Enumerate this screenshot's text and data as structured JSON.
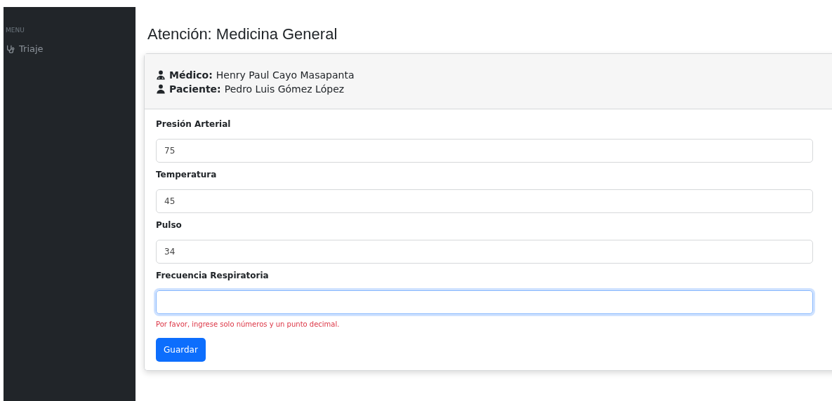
{
  "sidebar": {
    "heading": "MENU",
    "items": [
      {
        "label": "Triaje",
        "selected": false
      }
    ]
  },
  "page_title": "Atención: Medicina General",
  "header": {
    "doctor_label": "Médico:",
    "doctor": "Henry Paul Cayo Masapanta",
    "patient_label": "Paciente:",
    "patient": "Pedro Luis Gómez López"
  },
  "fields": [
    {
      "label": "Presión Arterial",
      "value": "75",
      "focused": false
    },
    {
      "label": "Temperatura",
      "value": "45",
      "focused": false
    },
    {
      "label": "Pulso",
      "value": "34",
      "focused": false
    },
    {
      "label": "Frecuencia Respiratoria",
      "focused": true,
      "error": "Por favor, ingrese solo números y un punto decimal."
    }
  ],
  "save_button": "Guardar"
}
